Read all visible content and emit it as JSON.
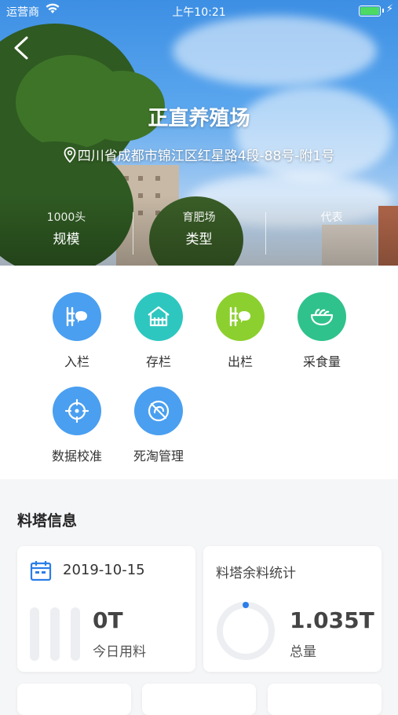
{
  "status_bar": {
    "carrier": "运营商",
    "time": "上午10:21"
  },
  "farm": {
    "name": "正直养殖场",
    "address": "四川省成都市锦江区红星路4段-88号-附1号"
  },
  "stats": [
    {
      "value": "1000头",
      "label": "规模"
    },
    {
      "value": "育肥场",
      "label": "类型"
    },
    {
      "value": "代表",
      "label": ""
    }
  ],
  "menu": [
    {
      "label": "入栏",
      "color": "#4a9ff0",
      "icon": "fence-in-icon"
    },
    {
      "label": "存栏",
      "color": "#2ec7c0",
      "icon": "barn-icon"
    },
    {
      "label": "出栏",
      "color": "#8cd02f",
      "icon": "fence-out-icon"
    },
    {
      "label": "采食量",
      "color": "#2fc28c",
      "icon": "food-bowl-icon"
    },
    {
      "label": "数据校准",
      "color": "#4a9ff0",
      "icon": "crosshair-icon"
    },
    {
      "label": "死淘管理",
      "color": "#4a9ff0",
      "icon": "death-management-icon"
    }
  ],
  "feed_tower": {
    "section_title": "料塔信息",
    "daily": {
      "date": "2019-10-15",
      "amount": "0T",
      "label": "今日用料"
    },
    "remaining": {
      "title": "料塔余料统计",
      "amount": "1.035T",
      "label": "总量",
      "accent": "#2b7de9"
    }
  }
}
